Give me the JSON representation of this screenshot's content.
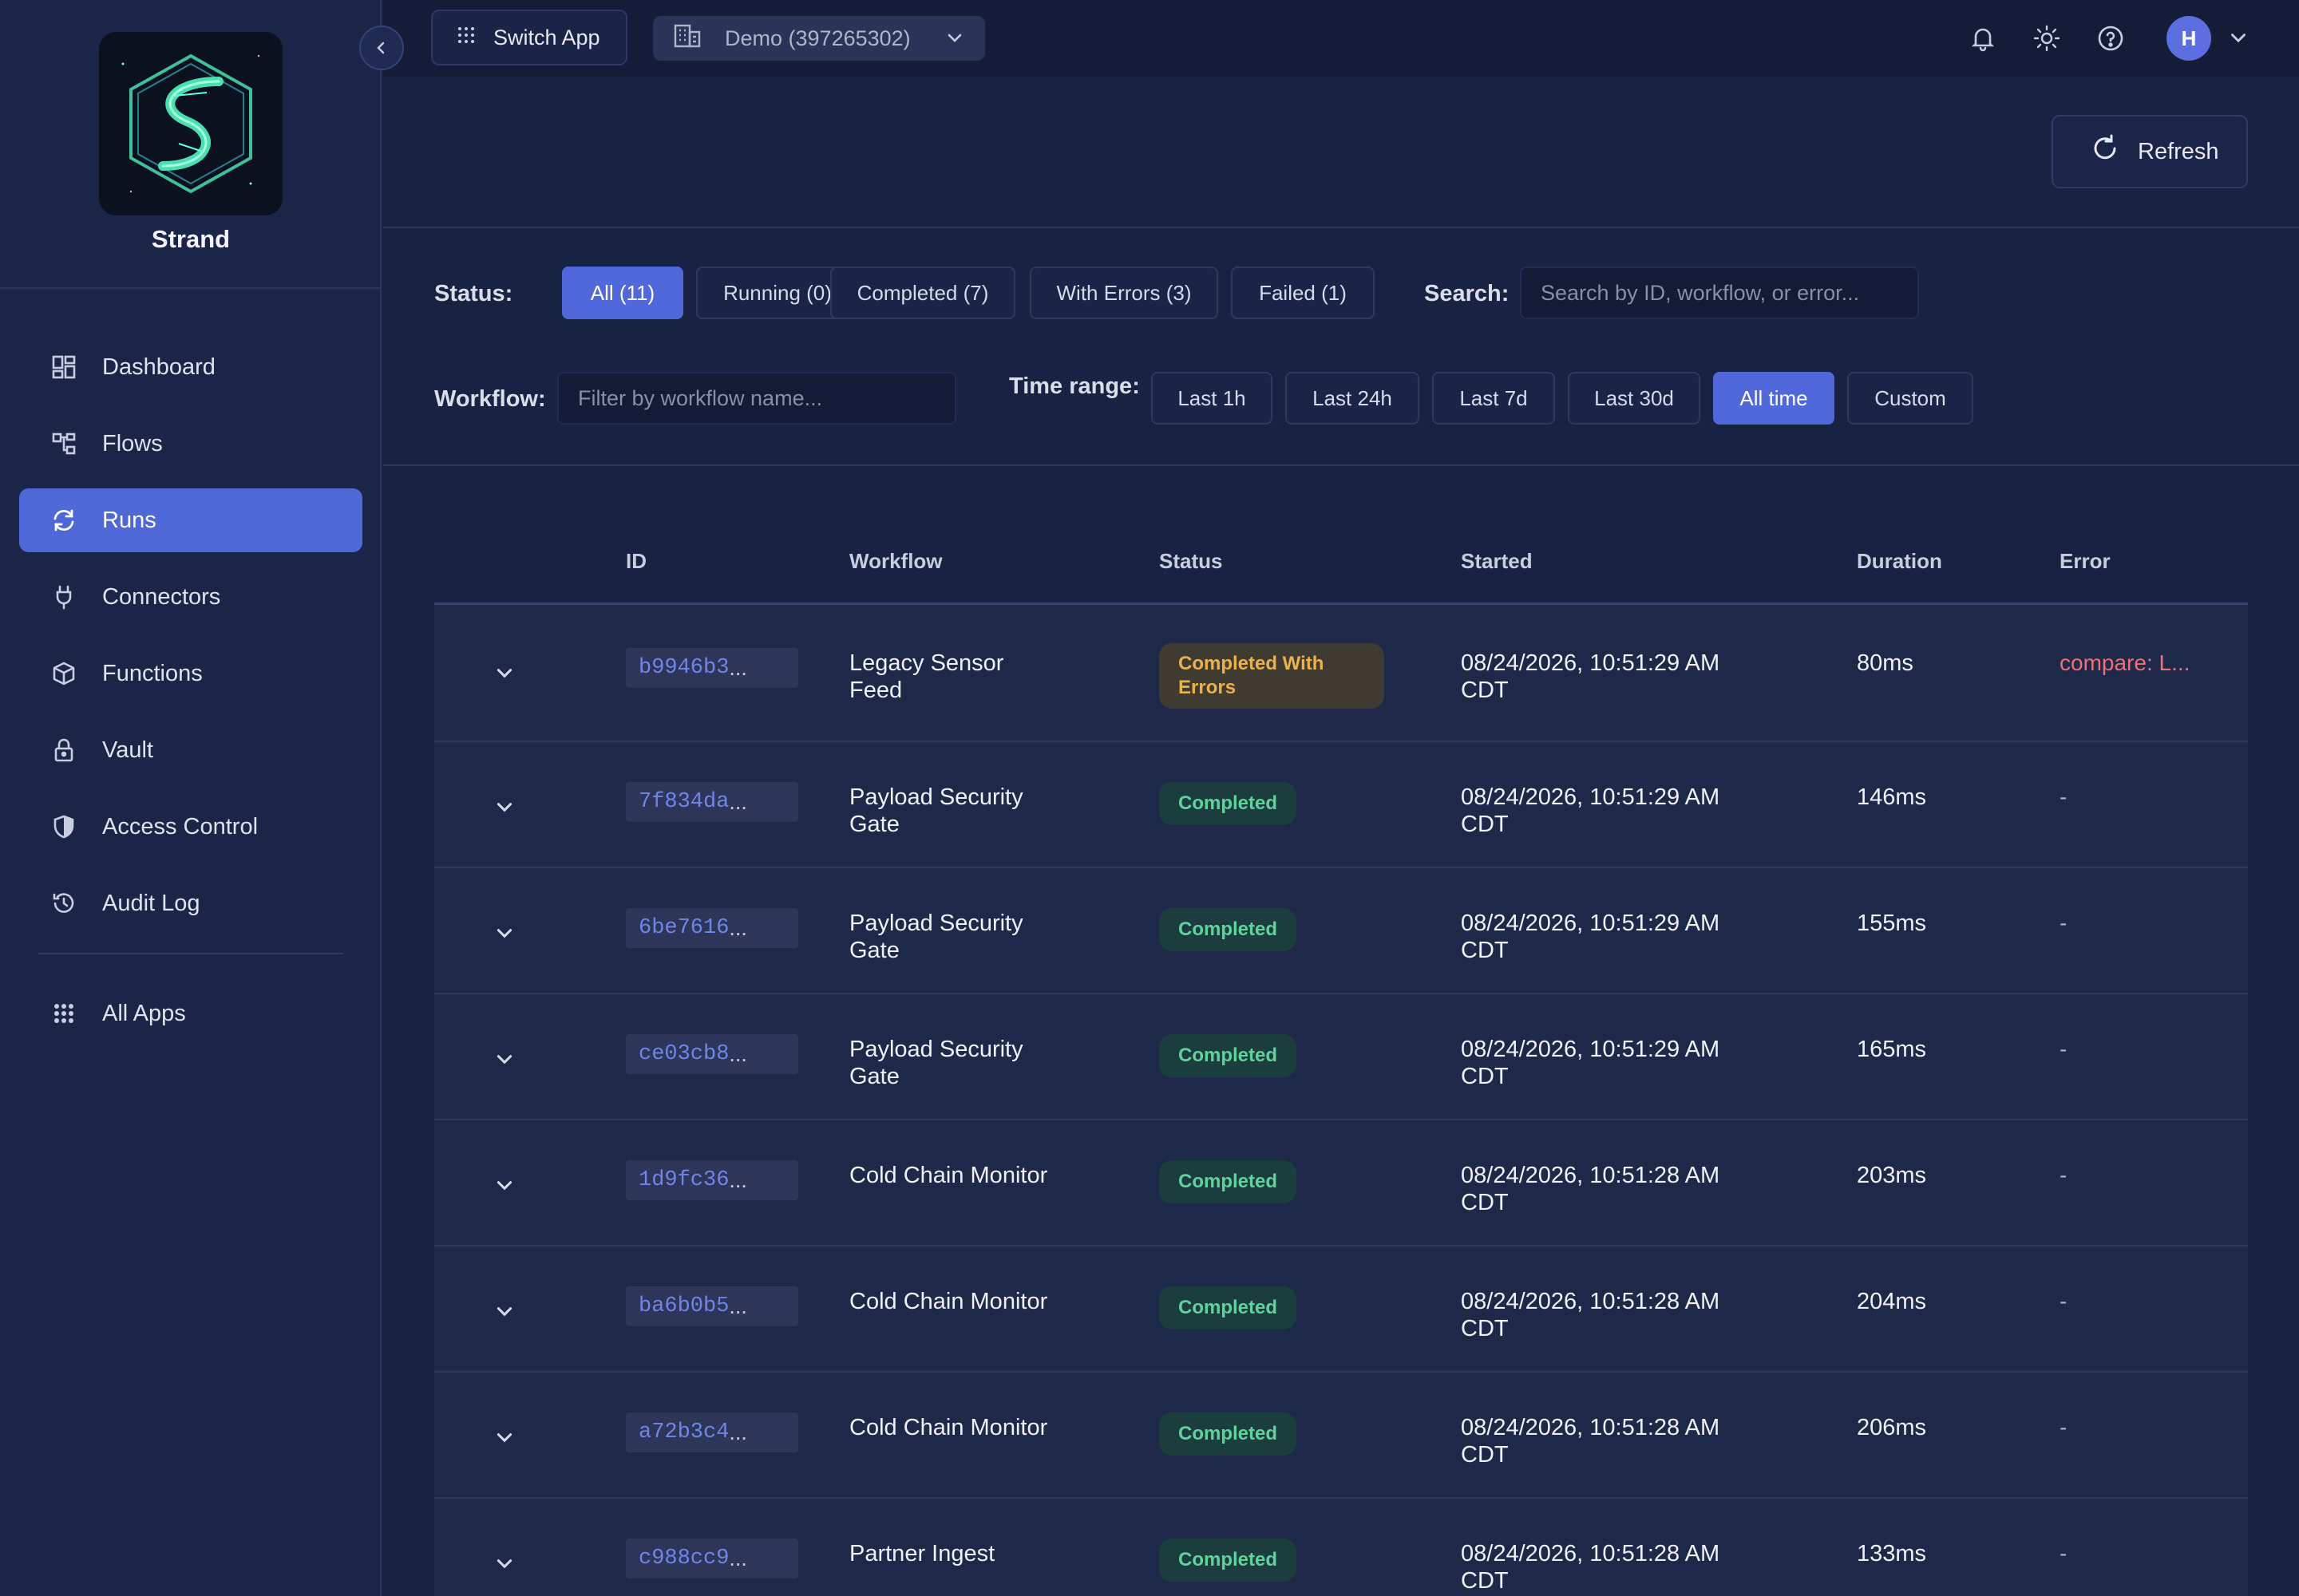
{
  "brand": {
    "name": "Strand"
  },
  "sidebar": {
    "items": [
      {
        "label": "Dashboard",
        "icon": "dashboard-icon",
        "active": false
      },
      {
        "label": "Flows",
        "icon": "flows-icon",
        "active": false
      },
      {
        "label": "Runs",
        "icon": "refresh-cycle-icon",
        "active": true
      },
      {
        "label": "Connectors",
        "icon": "plug-icon",
        "active": false
      },
      {
        "label": "Functions",
        "icon": "cube-icon",
        "active": false
      },
      {
        "label": "Vault",
        "icon": "lock-icon",
        "active": false
      },
      {
        "label": "Access Control",
        "icon": "shield-icon",
        "active": false
      },
      {
        "label": "Audit Log",
        "icon": "history-icon",
        "active": false
      }
    ],
    "all_apps": "All Apps"
  },
  "topbar": {
    "switch_app": "Switch App",
    "org": "Demo (397265302)",
    "avatar_initial": "H"
  },
  "header": {
    "refresh_label": "Refresh"
  },
  "filters": {
    "status_label": "Status:",
    "status_chips": [
      "All (11)",
      "Running (0)",
      "Completed (7)",
      "With Errors (3)",
      "Failed (1)"
    ],
    "search_label": "Search:",
    "search_placeholder": "Search by ID, workflow, or error...",
    "workflow_label": "Workflow:",
    "workflow_placeholder": "Filter by workflow name...",
    "time_label": "Time range:",
    "time_chips": [
      "Last 1h",
      "Last 24h",
      "Last 7d",
      "Last 30d",
      "All time",
      "Custom"
    ]
  },
  "table": {
    "columns": [
      "ID",
      "Workflow",
      "Status",
      "Started",
      "Duration",
      "Error"
    ],
    "rows": [
      {
        "id": "b9946b3",
        "workflow": [
          "Legacy Sensor",
          "Feed"
        ],
        "status": [
          "Completed With",
          "Errors"
        ],
        "status_kind": "warn",
        "started": [
          "08/24/2026, 10:51:29 AM",
          "CDT"
        ],
        "duration": "80ms",
        "error": "compare: L..."
      },
      {
        "id": "7f834da",
        "workflow": [
          "Payload Security",
          "Gate"
        ],
        "status": [
          "Completed"
        ],
        "status_kind": "ok",
        "started": [
          "08/24/2026, 10:51:29 AM",
          "CDT"
        ],
        "duration": "146ms",
        "error": "-"
      },
      {
        "id": "6be7616",
        "workflow": [
          "Payload Security",
          "Gate"
        ],
        "status": [
          "Completed"
        ],
        "status_kind": "ok",
        "started": [
          "08/24/2026, 10:51:29 AM",
          "CDT"
        ],
        "duration": "155ms",
        "error": "-"
      },
      {
        "id": "ce03cb8",
        "workflow": [
          "Payload Security",
          "Gate"
        ],
        "status": [
          "Completed"
        ],
        "status_kind": "ok",
        "started": [
          "08/24/2026, 10:51:29 AM",
          "CDT"
        ],
        "duration": "165ms",
        "error": "-"
      },
      {
        "id": "1d9fc36",
        "workflow": [
          "Cold Chain Monitor"
        ],
        "status": [
          "Completed"
        ],
        "status_kind": "ok",
        "started": [
          "08/24/2026, 10:51:28 AM",
          "CDT"
        ],
        "duration": "203ms",
        "error": "-"
      },
      {
        "id": "ba6b0b5",
        "workflow": [
          "Cold Chain Monitor"
        ],
        "status": [
          "Completed"
        ],
        "status_kind": "ok",
        "started": [
          "08/24/2026, 10:51:28 AM",
          "CDT"
        ],
        "duration": "204ms",
        "error": "-"
      },
      {
        "id": "a72b3c4",
        "workflow": [
          "Cold Chain Monitor"
        ],
        "status": [
          "Completed"
        ],
        "status_kind": "ok",
        "started": [
          "08/24/2026, 10:51:28 AM",
          "CDT"
        ],
        "duration": "206ms",
        "error": "-"
      },
      {
        "id": "c988cc9",
        "workflow": [
          "Partner Ingest"
        ],
        "status": [
          "Completed"
        ],
        "status_kind": "ok",
        "started": [
          "08/24/2026, 10:51:28 AM",
          "CDT"
        ],
        "duration": "133ms",
        "error": "-"
      }
    ]
  },
  "colors": {
    "accent": "#5068d9",
    "success": "#5ed49c",
    "warning": "#e9b24a",
    "error": "#ee6f7a"
  }
}
